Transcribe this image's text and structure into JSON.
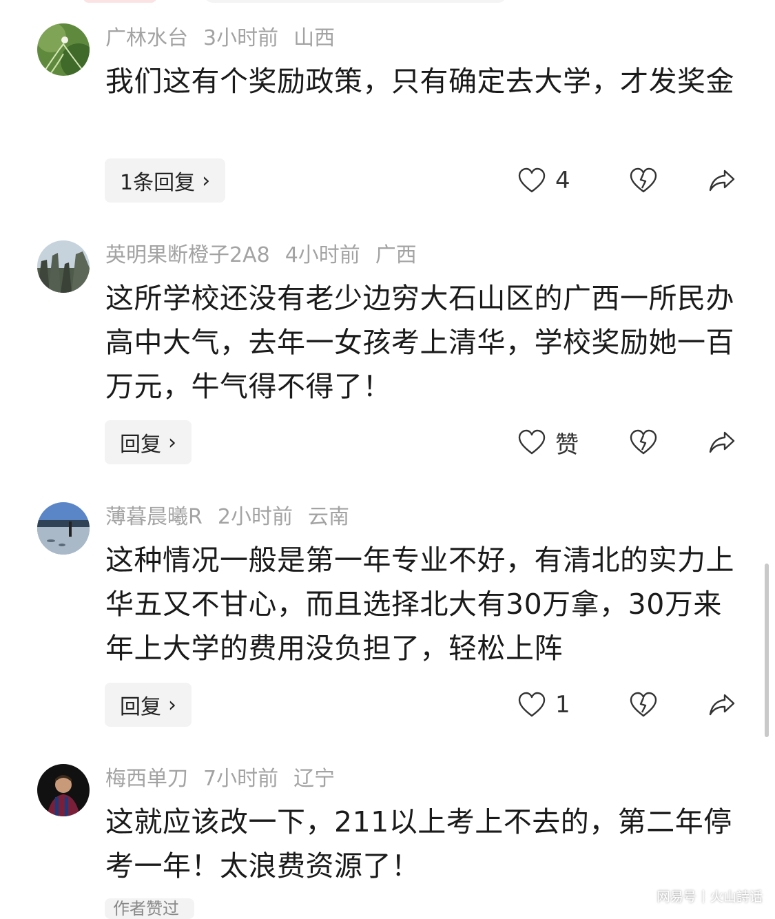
{
  "comments": [
    {
      "username": "广林水台",
      "time": "3小时前",
      "location": "山西",
      "text": "我们这有个奖励政策，只有确定去大学，才发奖金",
      "reply_label": "1条回复",
      "like_count": "4"
    },
    {
      "username": "英明果断橙子2A8",
      "time": "4小时前",
      "location": "广西",
      "text": "这所学校还没有老少边穷大石山区的广西一所民办高中大气，去年一女孩考上清华，学校奖励她一百万元，牛气得不得了！",
      "reply_label": "回复",
      "like_count": "赞"
    },
    {
      "username": "薄暮晨曦R",
      "time": "2小时前",
      "location": "云南",
      "text": "这种情况一般是第一年专业不好，有清北的实力上华五又不甘心，而且选择北大有30万拿，30万来年上大学的费用没负担了，轻松上阵",
      "reply_label": "回复",
      "like_count": "1"
    },
    {
      "username": "梅西单刀",
      "time": "7小时前",
      "location": "辽宁",
      "text": "这就应该改一下，211以上考上不去的，第二年停考一年！太浪费资源了！",
      "reply_label": "作者赞过"
    }
  ],
  "watermark": {
    "brand": "网易号",
    "account": "火山詩话"
  },
  "colors": {
    "meta_text": "#a3a3a3",
    "body_text": "#1a1a1a",
    "chip_bg": "#f3f3f3"
  },
  "icons": [
    "heart-icon",
    "broken-heart-icon",
    "share-icon",
    "chevron-right-icon"
  ]
}
